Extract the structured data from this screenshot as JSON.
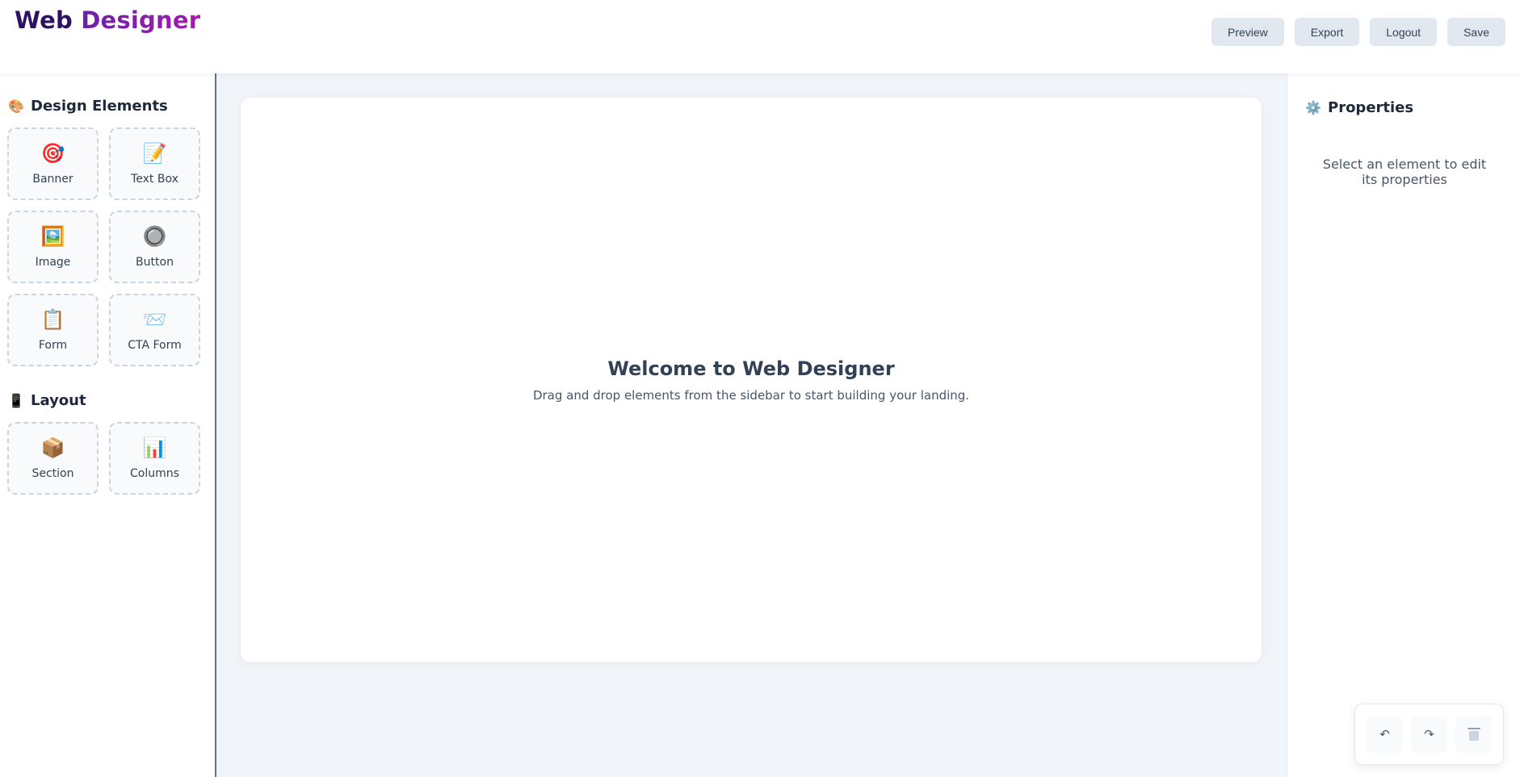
{
  "header": {
    "logo_part1": "Web",
    "logo_part2": "Designer",
    "buttons": {
      "preview": "Preview",
      "export": "Export",
      "logout": "Logout",
      "save": "Save"
    }
  },
  "left_sidebar": {
    "design_elements": {
      "title": "Design Elements",
      "icon": "🎨",
      "items": [
        {
          "label": "Banner",
          "icon": "🎯"
        },
        {
          "label": "Text Box",
          "icon": "📝"
        },
        {
          "label": "Image",
          "icon": "🖼️"
        },
        {
          "label": "Button",
          "icon": "🔘"
        },
        {
          "label": "Form",
          "icon": "📋"
        },
        {
          "label": "CTA Form",
          "icon": "📨"
        }
      ]
    },
    "layout": {
      "title": "Layout",
      "icon": "📱",
      "items": [
        {
          "label": "Section",
          "icon": "📦"
        },
        {
          "label": "Columns",
          "icon": "📊"
        }
      ]
    }
  },
  "canvas": {
    "welcome_title": "Welcome to Web Designer",
    "welcome_subtitle": "Drag and drop elements from the sidebar to start building your landing."
  },
  "right_sidebar": {
    "title": "Properties",
    "icon": "⚙️",
    "hint": "Select an element to edit its properties"
  },
  "toolbar": {
    "undo_icon": "↶",
    "redo_icon": "↷",
    "delete_icon": "trash-icon"
  },
  "colors": {
    "logo_dark": "#2e1065",
    "logo_accent": "#a21caf",
    "button_bg": "#e2e8f0",
    "workspace_bg": "#f1f5f9",
    "card_border": "#cbd5e1"
  }
}
